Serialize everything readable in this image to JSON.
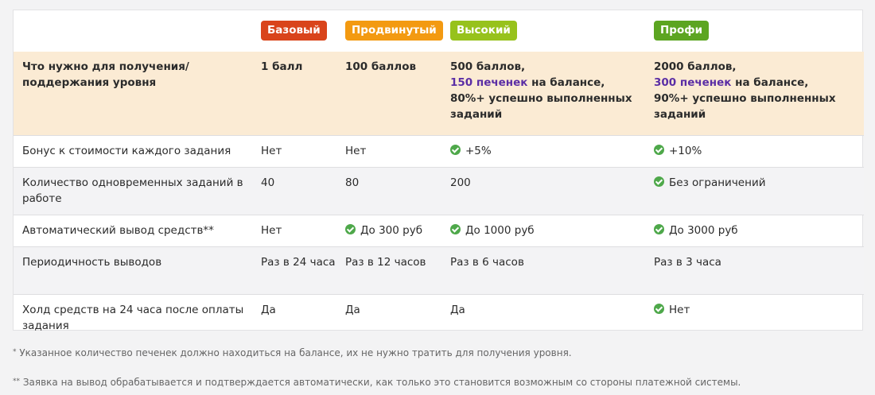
{
  "levels": [
    {
      "name": "Базовый",
      "color": "#d9441b"
    },
    {
      "name": "Продвинутый",
      "color": "#f39a11"
    },
    {
      "name": "Высокий",
      "color": "#97c21c"
    },
    {
      "name": "Профи",
      "color": "#5ca521"
    }
  ],
  "requirement": {
    "label": "Что нужно для получения/поддержания уровня",
    "basic": "1 балл",
    "advanced": "100 баллов",
    "high": {
      "line1": "500 баллов,",
      "cookies": "150 печенек",
      "cookies_tail": " на балансе,",
      "line3": "80%+ успешно выполненных заданий"
    },
    "pro": {
      "line1": "2000 баллов,",
      "cookies": "300 печенек",
      "cookies_tail": " на балансе,",
      "line3": "90%+ успешно выполненных заданий"
    }
  },
  "rows": [
    {
      "label": "Бонус к стоимости каждого задания",
      "basic": "Нет",
      "advanced": "Нет",
      "high": "+5%",
      "pro": "+10%"
    },
    {
      "label": "Количество одновременных заданий в работе",
      "basic": "40",
      "advanced": "80",
      "high": "200",
      "pro": "Без ограничений"
    },
    {
      "label": "Автоматический вывод средств**",
      "basic": "Нет",
      "advanced": "До 300 руб",
      "high": "До 1000 руб",
      "pro": "До 3000 руб"
    },
    {
      "label": "Периодичность выводов",
      "basic": "Раз в 24 часа",
      "advanced": "Раз в 12 часов",
      "high": "Раз в 6 часов",
      "pro": "Раз в 3 часа"
    },
    {
      "label": "Холд средств на 24 часа после оплаты задания",
      "basic": "Да",
      "advanced": "Да",
      "high": "Да",
      "pro": "Нет"
    }
  ],
  "footnotes": {
    "note1_star": "*",
    "note1": " Указанное количество печенек должно находиться на балансе, их не нужно тратить для получения уровня.",
    "note2_star": "**",
    "note2": " Заявка на вывод обрабатывается и подтверждается автоматически, как только это становится возможным со стороны платежной системы."
  },
  "icons": {
    "check": "check-circle-icon"
  }
}
